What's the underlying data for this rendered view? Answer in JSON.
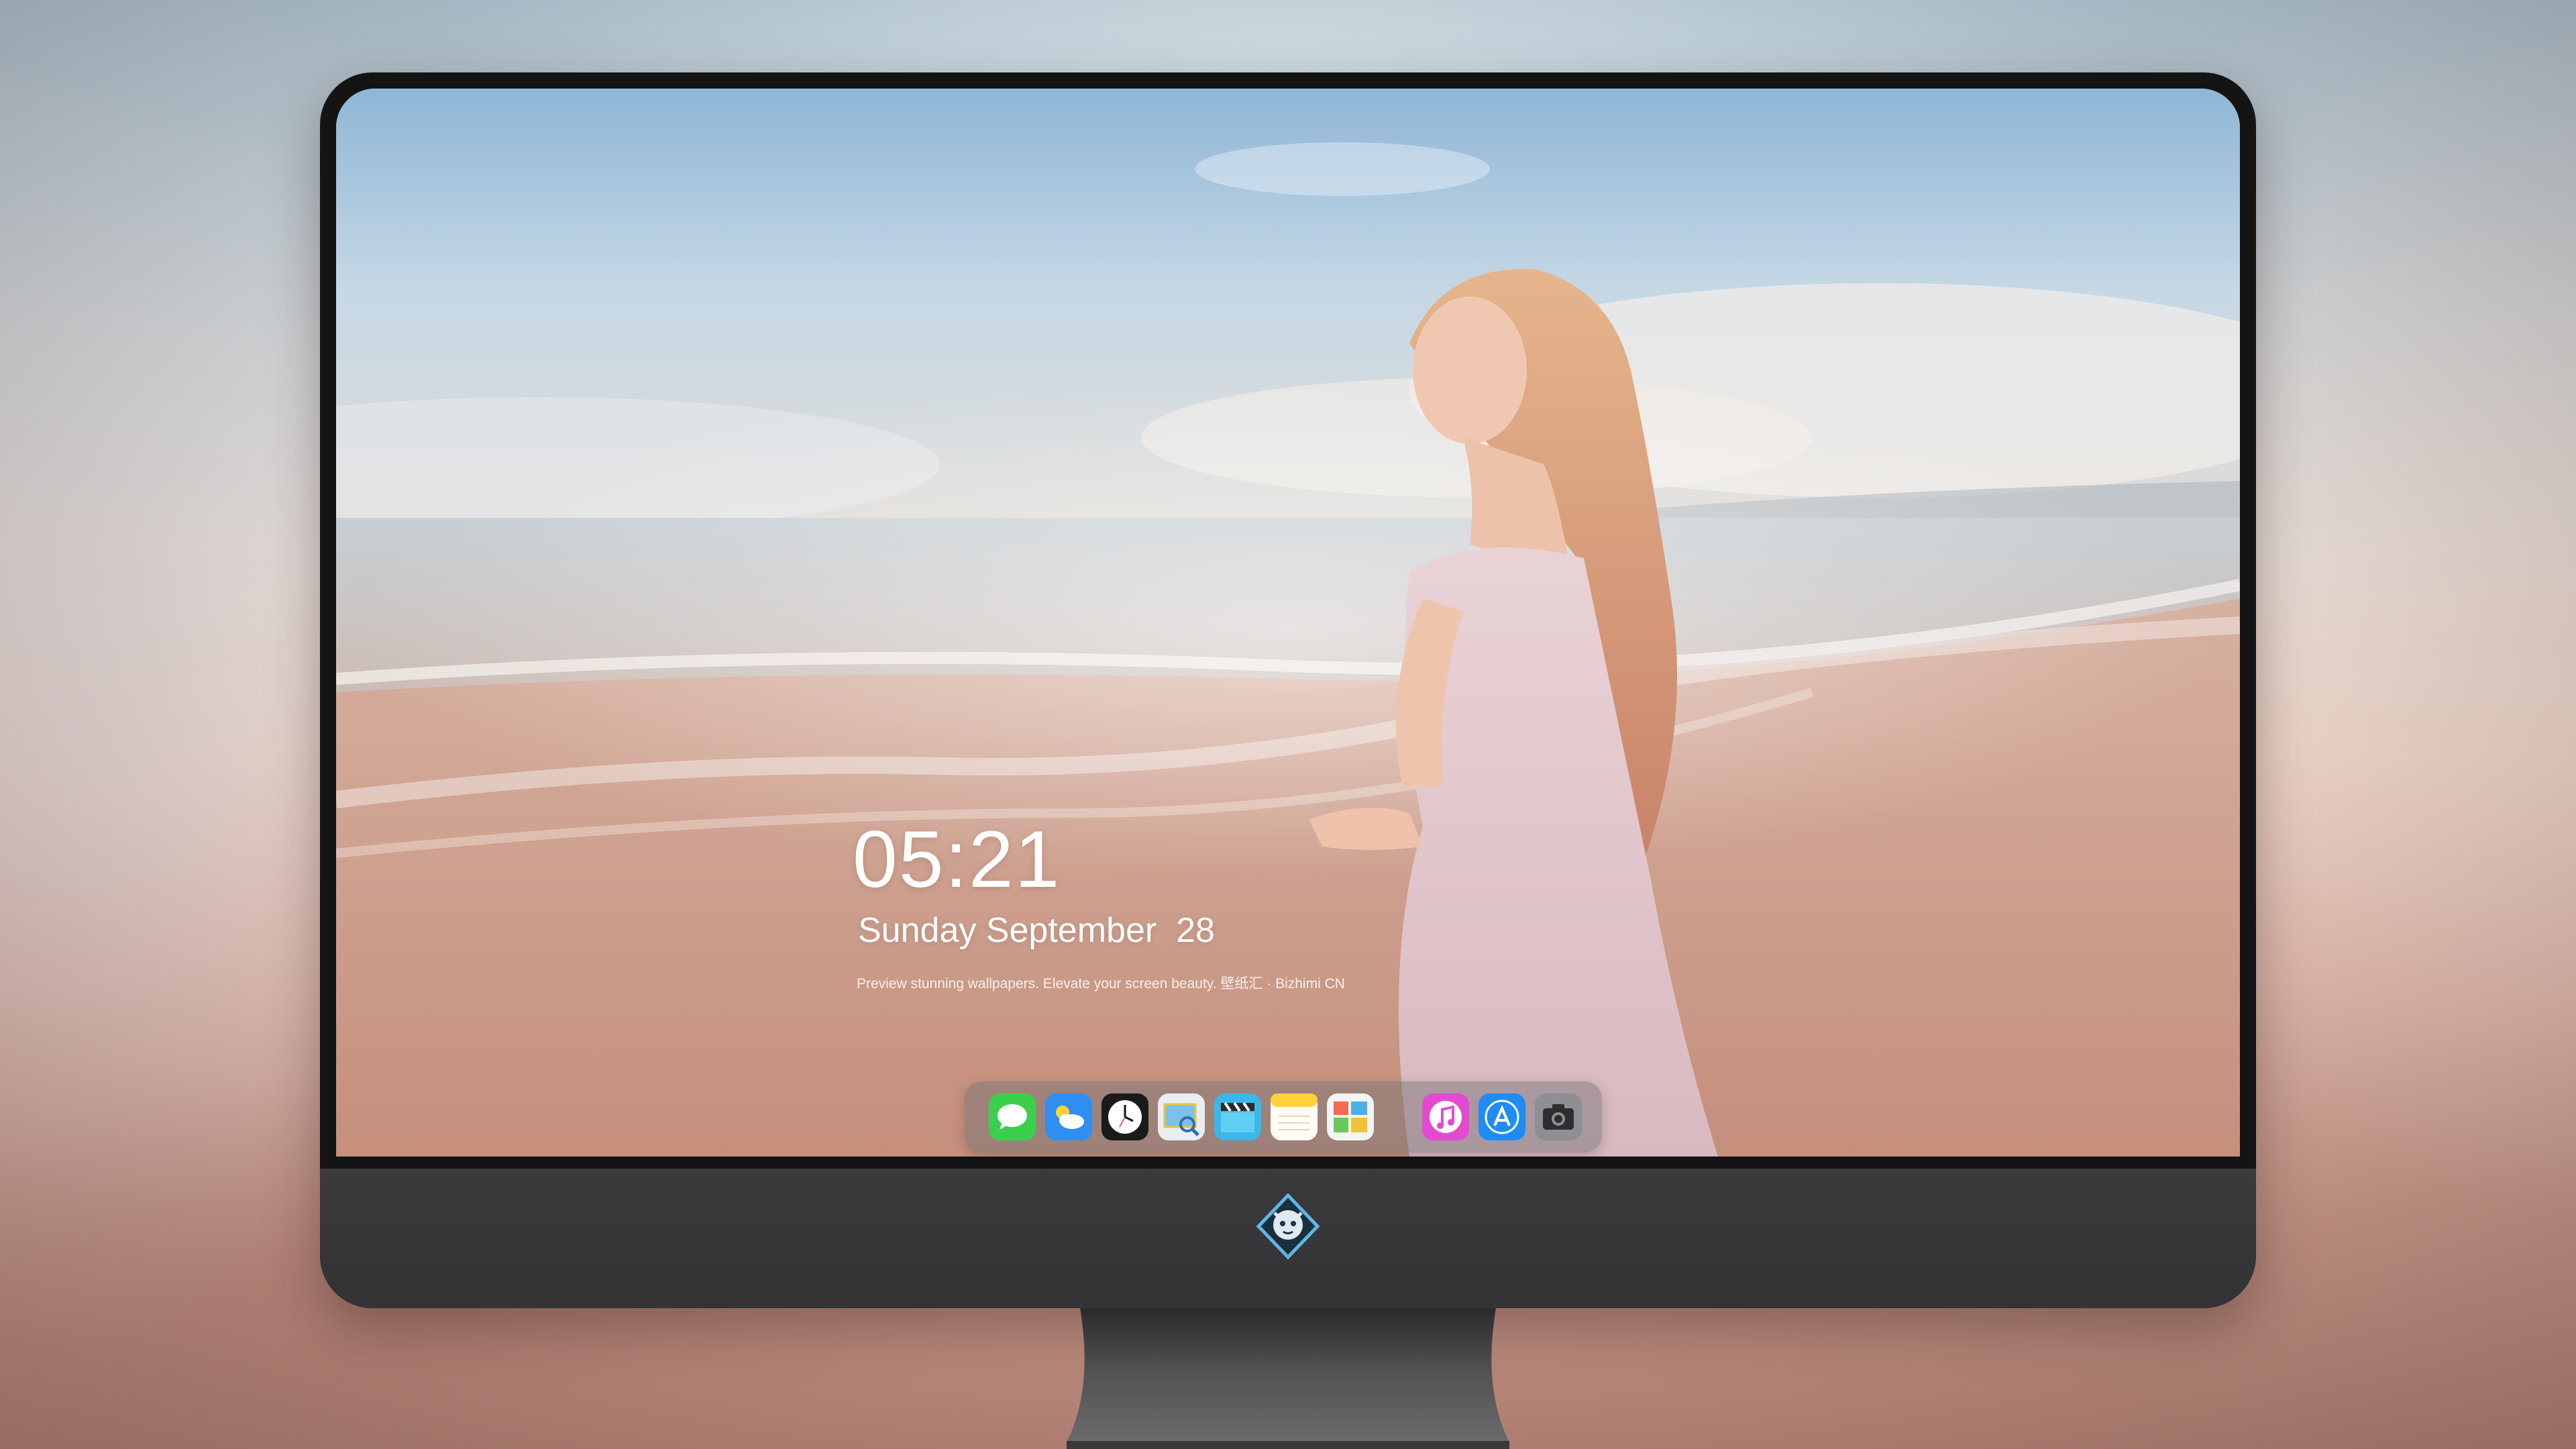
{
  "lockscreen": {
    "time": "05:21",
    "date": "Sunday September  28",
    "caption": "Preview stunning wallpapers. Elevate your screen beauty. 壁纸汇 · Bizhimi CN"
  },
  "dock": {
    "apps": [
      {
        "name": "messages",
        "icon": "messages-icon"
      },
      {
        "name": "weather",
        "icon": "weather-icon"
      },
      {
        "name": "clock",
        "icon": "clock-icon"
      },
      {
        "name": "preview",
        "icon": "preview-icon"
      },
      {
        "name": "video",
        "icon": "clapperboard-icon"
      },
      {
        "name": "notes",
        "icon": "notes-icon"
      },
      {
        "name": "photos",
        "icon": "photo-gallery-icon"
      },
      {
        "name": "music",
        "icon": "music-icon"
      },
      {
        "name": "app-store",
        "icon": "app-store-icon"
      },
      {
        "name": "camera",
        "icon": "camera-icon"
      }
    ]
  },
  "monitor": {
    "logo": "mascot-logo-icon"
  },
  "colors": {
    "bezel": "#141414",
    "chin": "#3b3a3c",
    "dock_bg": "rgba(110,110,115,0.45)",
    "text": "#ffffff"
  }
}
